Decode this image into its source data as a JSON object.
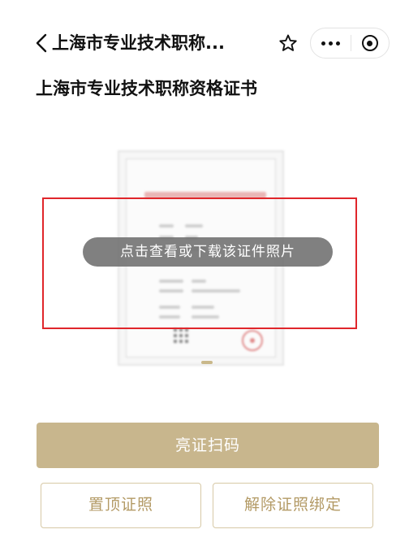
{
  "nav": {
    "title": "上海市专业技术职称...",
    "back_icon": "chevron-left-icon",
    "favorite_icon": "star-outline-icon",
    "more_icon": "more-dots-icon",
    "close_icon": "target-close-icon"
  },
  "page": {
    "heading": "上海市专业技术职称资格证书"
  },
  "certificate": {
    "tip": "点击查看或下载该证件照片"
  },
  "actions": {
    "primary_label": "亮证扫码",
    "pin_label": "置顶证照",
    "unbind_label": "解除证照绑定"
  },
  "colors": {
    "primary": "#c8b68d",
    "outline_text": "#b39a65",
    "annotation": "#e0262b"
  }
}
